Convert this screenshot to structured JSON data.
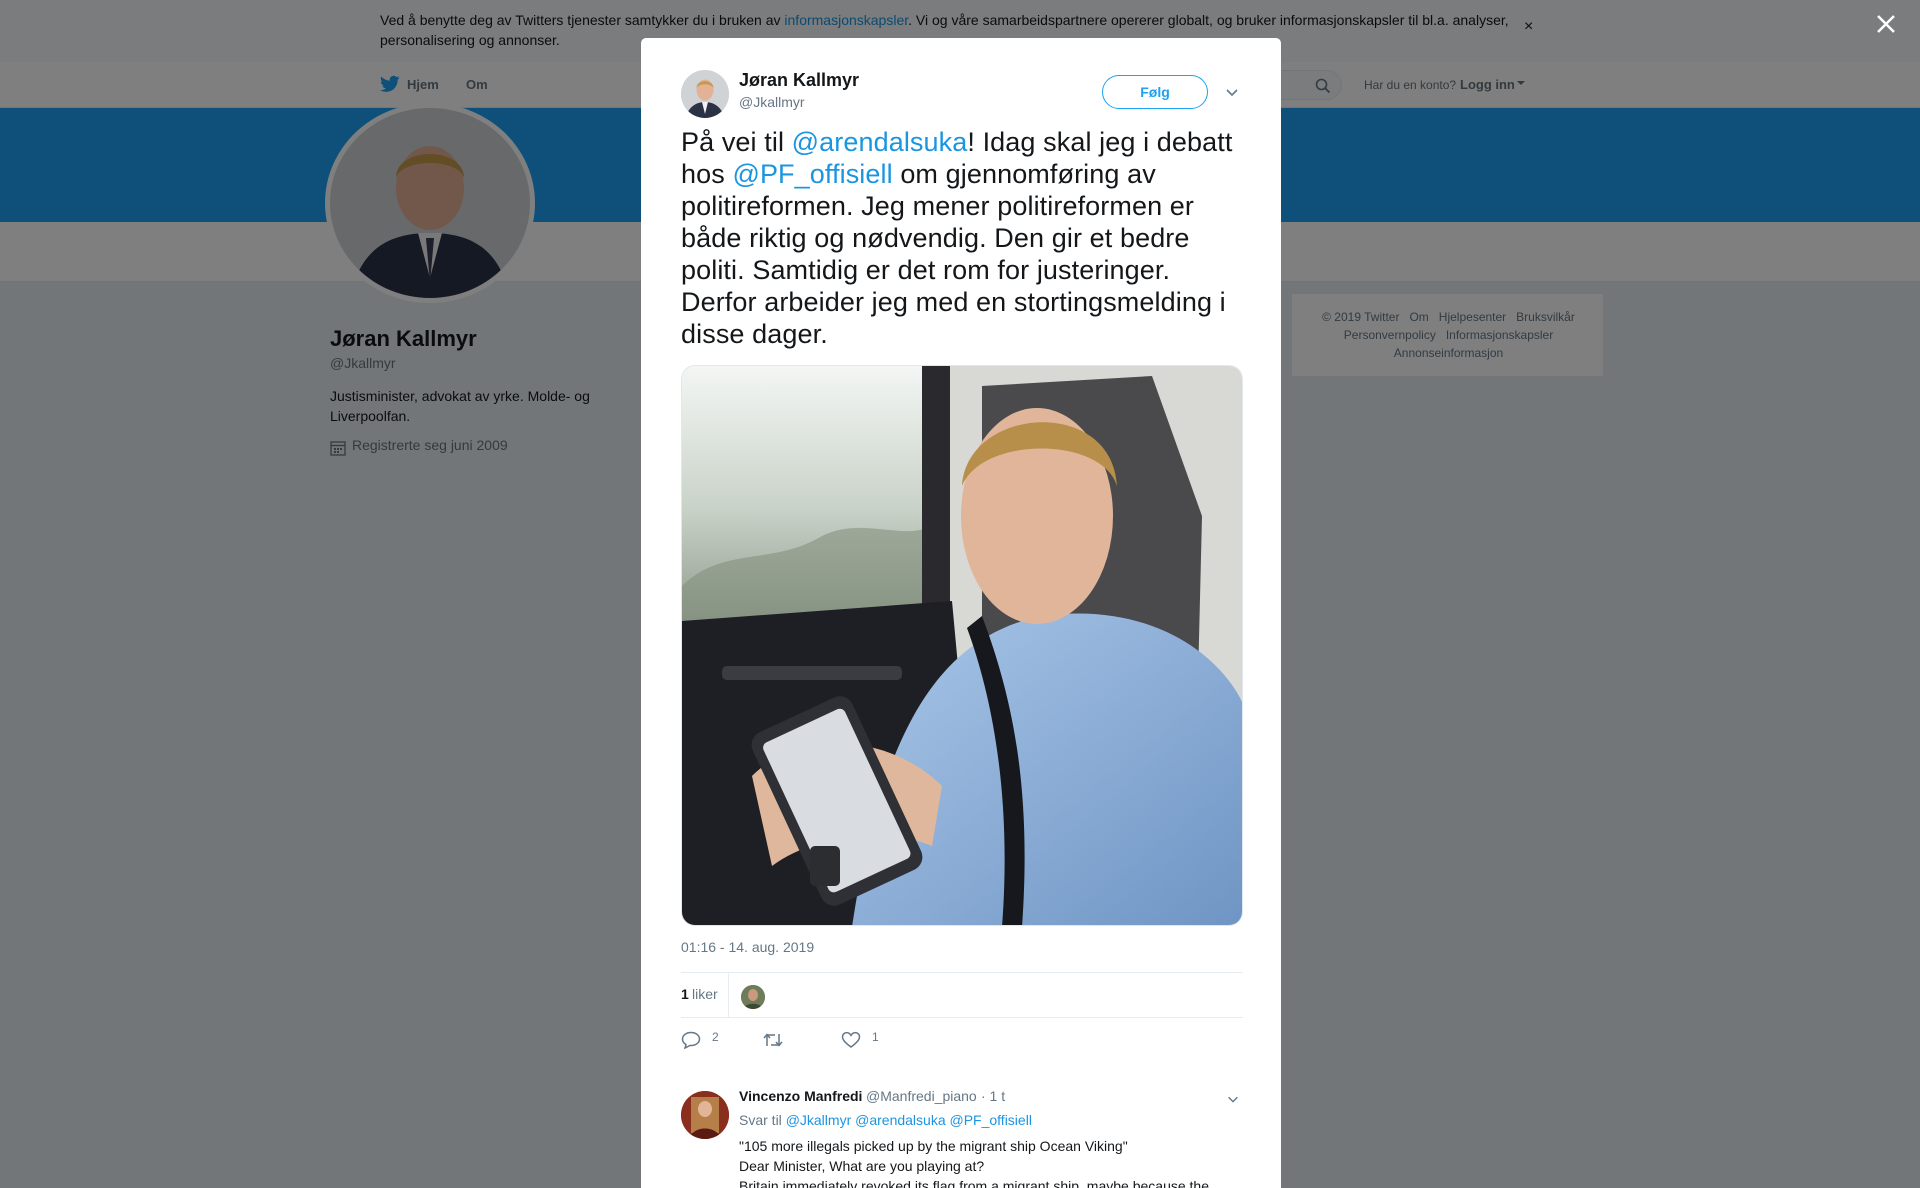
{
  "cookie_bar": {
    "text_before": "Ved å benytte deg av Twitters tjenester samtykker du i bruken av ",
    "link_text": "informasjonskapsler",
    "text_after": ". Vi og våre samarbeidspartnere opererer globalt, og bruker informasjonskapsler til bl.a. analyser, personalisering og annonser.",
    "close_icon": "×"
  },
  "topnav": {
    "home": "Hjem",
    "about": "Om",
    "account_prompt": "Har du en konto?",
    "login": "Logg inn"
  },
  "profile": {
    "name": "Jøran Kallmyr",
    "handle": "@Jkallmyr",
    "bio": "Justisminister, advokat av yrke. Molde- og Liverpoolfan.",
    "joined": "Registrerte seg juni 2009"
  },
  "footer": {
    "links": [
      "© 2019 Twitter",
      "Om",
      "Hjelpesenter",
      "Bruksvilkår",
      "Personvernpolicy",
      "Informasjonskapsler",
      "Annonseinformasjon"
    ]
  },
  "tweet": {
    "author_name": "Jøran Kallmyr",
    "author_handle": "@Jkallmyr",
    "follow_label": "Følg",
    "text_1": "På vei til ",
    "mention_1": "@arendalsuka",
    "text_2": "! Idag skal jeg i debatt hos ",
    "mention_2": "@PF_offisiell",
    "text_3": " om gjennomføring av politireformen. Jeg mener politireformen er både riktig og nødvendig. Den gir et bedre politi. Samtidig er det rom for justeringer. Derfor arbeider jeg med en stortingsmelding i disse dager.",
    "timestamp": "01:16 - 14. aug. 2019",
    "likes_count": "1",
    "likes_label": "liker",
    "reply_count": "2",
    "retweet_count": "",
    "like_count": "1"
  },
  "reply": {
    "name": "Vincenzo Manfredi",
    "handle": "@Manfredi_piano",
    "time": "· 1 t",
    "replying_to_label": "Svar til ",
    "replying_to": "@Jkallmyr @arendalsuka @PF_offisiell",
    "body": "\"105 more illegals picked up by the migrant ship Ocean Viking\"\nDear Minister, What are you playing at?\nBritain immediately revoked its flag from a migrant ship, maybe because the"
  },
  "colors": {
    "brand_blue": "#1da1f2",
    "link_blue": "#1b95e0",
    "background": "#e6ecf0"
  }
}
